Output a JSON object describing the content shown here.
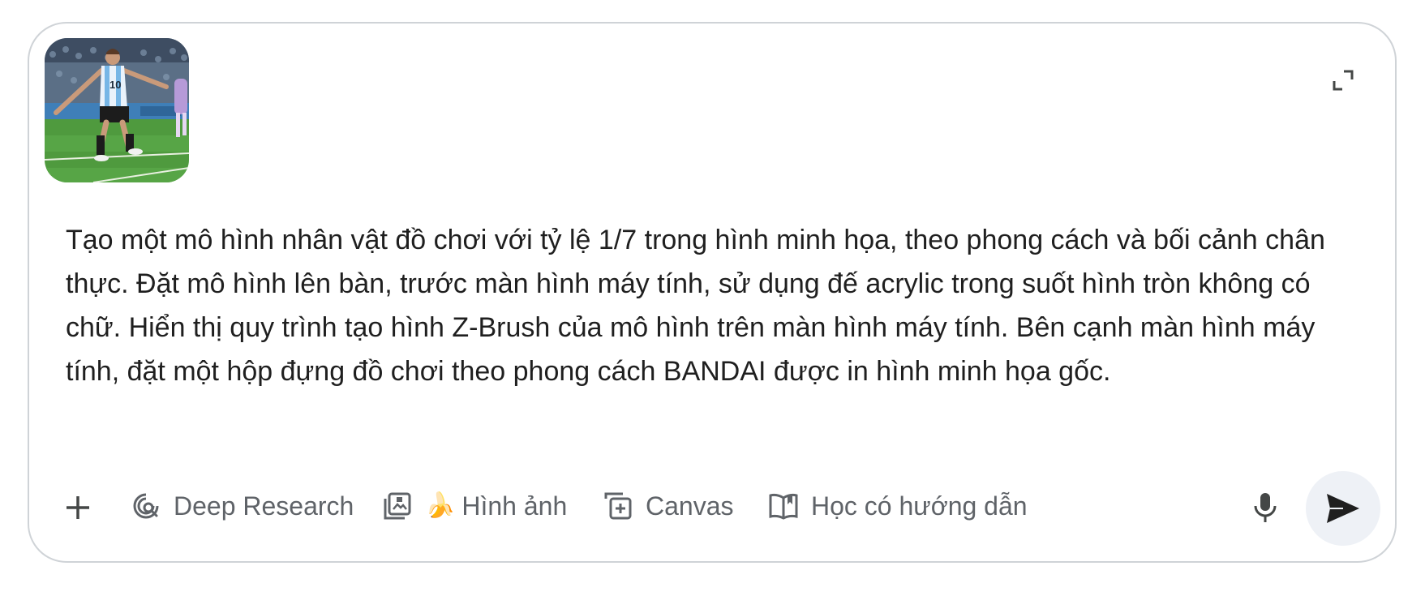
{
  "composer": {
    "attachment": {
      "icon": "image-thumbnail-soccer-player"
    },
    "expand_icon": "expand-icon",
    "prompt_text": "Tạo một mô hình nhân vật đồ chơi với tỷ lệ 1/7 trong hình minh họa, theo phong cách và bối cảnh chân thực. Đặt mô hình lên bàn, trước màn hình máy tính, sử dụng đế acrylic trong suốt hình tròn không có chữ. Hiển thị quy trình tạo hình Z-Brush của mô hình trên màn hình máy tính. Bên cạnh màn hình máy tính, đặt một hộp đựng đồ chơi theo phong cách BANDAI được in hình minh họa gốc."
  },
  "toolbar": {
    "add_icon": "plus-icon",
    "tools": [
      {
        "label": "Deep Research",
        "icon": "deep-research-icon"
      },
      {
        "label": "Hình ảnh",
        "icon": "image-gallery-icon",
        "emoji": "🍌"
      },
      {
        "label": "Canvas",
        "icon": "canvas-icon"
      },
      {
        "label": "Học có hướng dẫn",
        "icon": "open-book-icon"
      }
    ],
    "mic_icon": "microphone-icon",
    "send_icon": "send-icon"
  },
  "colors": {
    "border": "#cfd3d7",
    "text": "#1f1f1f",
    "muted": "#5f6368",
    "send_bg": "#eef1f6",
    "send_arrow": "#1f1f1f"
  }
}
